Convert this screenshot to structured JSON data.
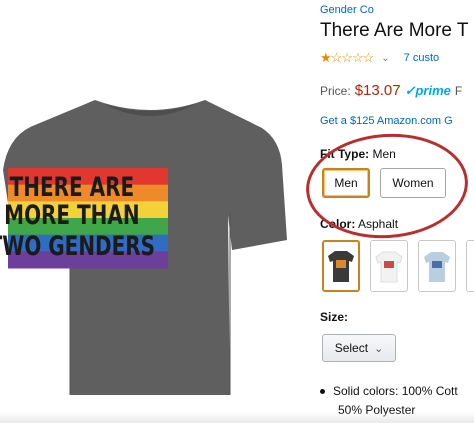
{
  "product_image": {
    "print_lines": [
      "THERE ARE",
      "MORE THAN",
      "TWO GENDERS"
    ],
    "shirt_color": "#5f5f5f",
    "stripe_colors": [
      "#e2372f",
      "#ef8a2a",
      "#f2d13a",
      "#3fa64a",
      "#2f6cc2",
      "#6d3f9c"
    ]
  },
  "details": {
    "brand": "Gender Co",
    "title": "There Are More T",
    "rating_stars": "★☆☆☆☆",
    "rating_chevron": "⌄",
    "review_count": "7 custo",
    "price_label": "Price:",
    "price": "$13.07",
    "prime": "✓prime",
    "prime_suffix": "F",
    "promo": "Get a $125 Amazon.com G",
    "fit_type_label": "Fit Type:",
    "fit_type_value": "Men",
    "fit_options": [
      "Men",
      "Women"
    ],
    "color_label": "Color:",
    "color_value": "Asphalt",
    "size_label": "Size:",
    "select_label": "Select",
    "select_chevron": "⌄",
    "bullet_line1": "Solid colors: 100% Cott",
    "bullet_line2": "50% Polyester"
  },
  "annotation_color": "#b7302f"
}
